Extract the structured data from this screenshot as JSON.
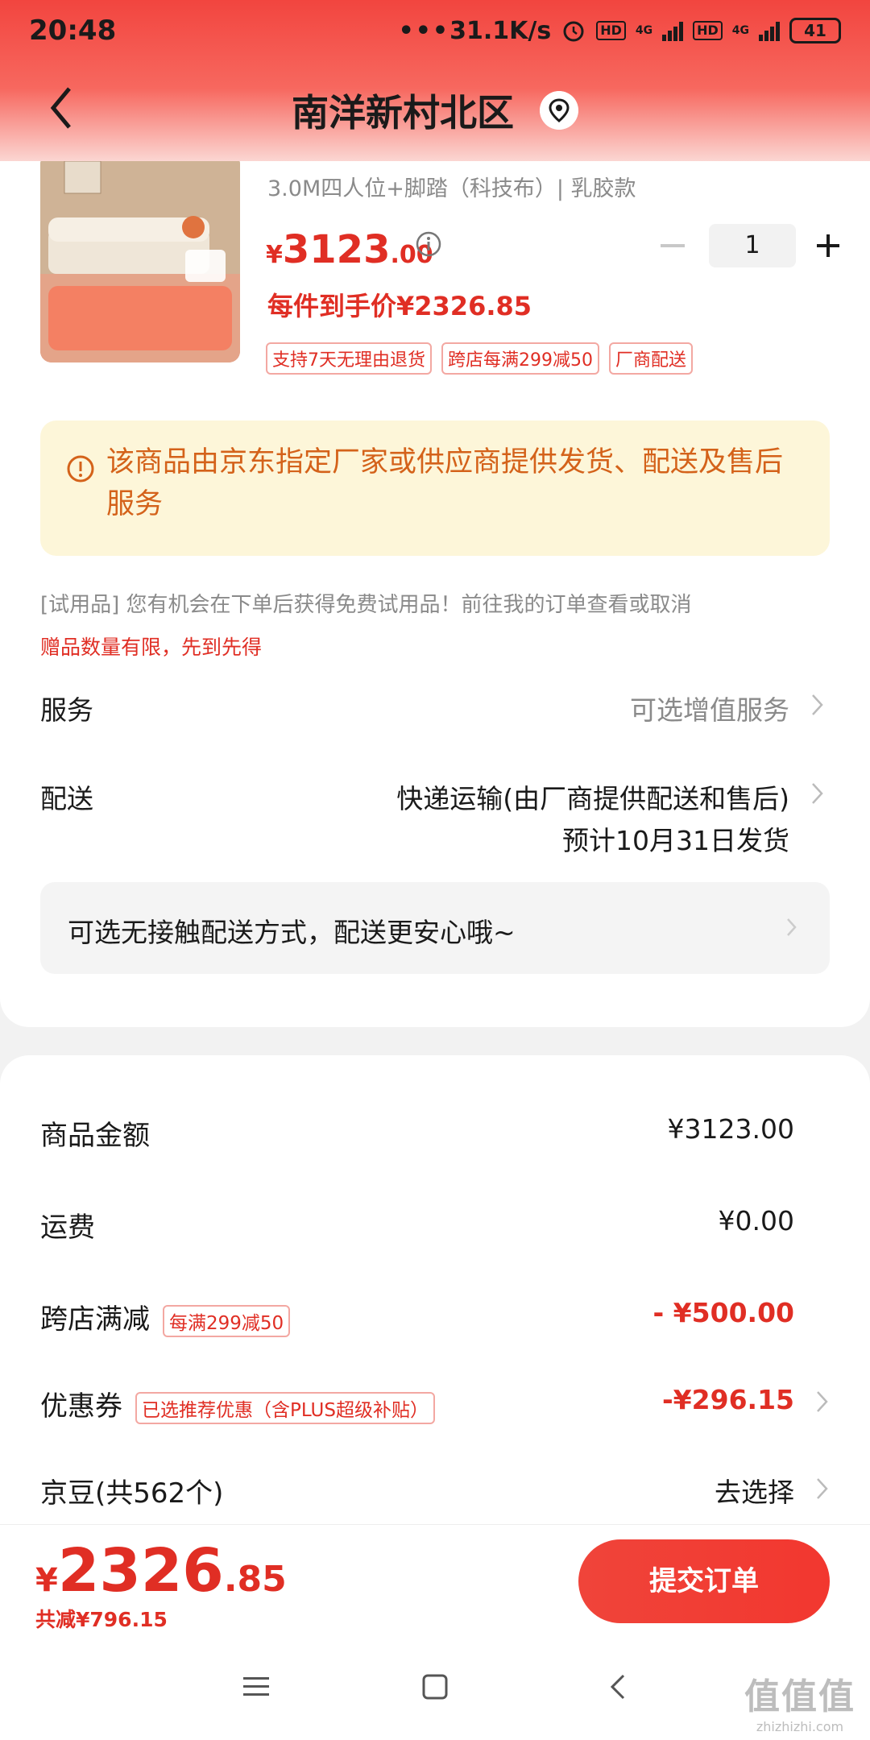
{
  "status_bar": {
    "time": "20:48",
    "net_speed": "31.1K/s",
    "hd1": "HD",
    "hd2": "HD",
    "sig1": "4G",
    "sig2": "4G",
    "battery": "41"
  },
  "header": {
    "title": "南洋新村北区"
  },
  "product": {
    "spec": "3.0M四人位+脚踏（科技布）| 乳胶款",
    "price_yen": "¥",
    "price_int": "3123",
    "price_dec": ".00",
    "quantity": "1",
    "final_price": "每件到手价¥2326.85",
    "tags": [
      "支持7天无理由退货",
      "跨店每满299减50",
      "厂商配送"
    ]
  },
  "notice": {
    "text": "该商品由京东指定厂家或供应商提供发货、配送及售后服务"
  },
  "trial": {
    "text": "[试用品] 您有机会在下单后获得免费试用品！前往我的订单查看或取消",
    "limited": "赠品数量有限，先到先得"
  },
  "service": {
    "label": "服务",
    "value": "可选增值服务"
  },
  "delivery": {
    "label": "配送",
    "value": "快递运输(由厂商提供配送和售后)",
    "date": "预计10月31日发货"
  },
  "contactless": {
    "text": "可选无接触配送方式，配送更安心哦~"
  },
  "summary": {
    "goods_label": "商品金额",
    "goods_value": "¥3123.00",
    "shipping_label": "运费",
    "shipping_value": "¥0.00",
    "crossstore_label": "跨店满减",
    "crossstore_tag": "每满299减50",
    "crossstore_value": "- ¥500.00",
    "coupon_label": "优惠券",
    "coupon_tag": "已选推荐优惠（含PLUS超级补贴）",
    "coupon_value": "-¥296.15",
    "beans_label": "京豆(共562个)",
    "beans_value": "去选择"
  },
  "bottom": {
    "total_yen": "¥",
    "total_int": "2326",
    "total_dec": ".85",
    "saved": "共减¥796.15",
    "submit": "提交订单"
  },
  "watermark": {
    "big": "值值值",
    "small": "zhizhizhi.com"
  },
  "colors": {
    "accent": "#e02e24",
    "notice_bg": "#fdf6d9",
    "notice_text": "#d4621a"
  }
}
